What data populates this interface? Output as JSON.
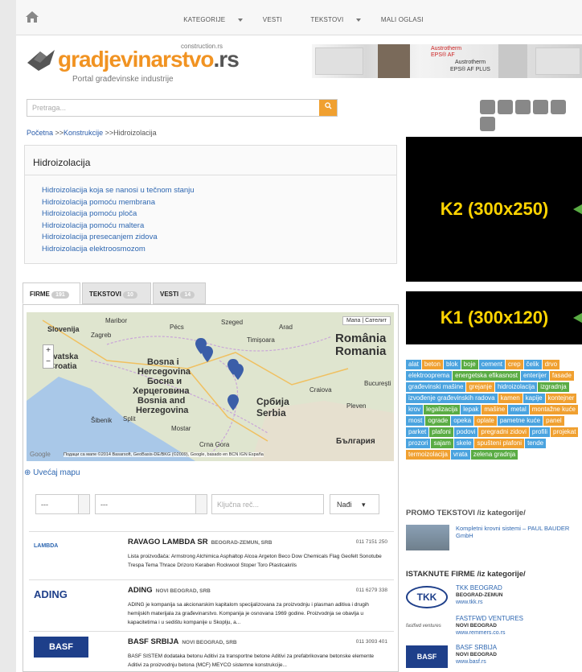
{
  "nav": {
    "items": [
      "KATEGORIJE",
      "VESTI",
      "TEKSTOVI",
      "MALI OGLASI"
    ]
  },
  "logo": {
    "small": "construction.rs",
    "name": "gradjevinarstvo",
    "tld": ".rs",
    "subtitle": "Portal građevinske industrije"
  },
  "top_banner": {
    "line1": "Austrotherm",
    "line2": "EPS® AF",
    "line3": "Austrotherm",
    "line4": "EPS® AF PLUS"
  },
  "search": {
    "placeholder": "Pretraga..."
  },
  "breadcrumb": {
    "home": "Početna",
    "sep1": " >>",
    "level1": "Konstrukcije",
    "sep2": " >>",
    "current": "Hidroizolacija"
  },
  "category": {
    "title": "Hidroizolacija",
    "items": [
      "Hidroizolacija koja se nanosi u tečnom stanju",
      "Hidroizolacija pomoću membrana",
      "Hidroizolacija pomoću ploča",
      "Hidroizolacija pomoću maltera",
      "Hidroizolacija presecanjem zidova",
      "Hidroizolacija elektroosmozom"
    ]
  },
  "tabs": [
    {
      "label": "FIRME",
      "count": "191"
    },
    {
      "label": "TEKSTOVI",
      "count": "10"
    },
    {
      "label": "VESTI",
      "count": "14"
    }
  ],
  "map": {
    "controls": "Мапа | Сателит",
    "labels": [
      "Slovenija",
      "Zagreb",
      "Hrvatska",
      "Croatia",
      "Bosna i",
      "Hercegovina",
      "Босна и",
      "Херцеговина",
      "Bosnia and",
      "Herzegovina",
      "Србија",
      "Serbia",
      "România",
      "Romania",
      "Crna Gora",
      "България",
      "Szeged",
      "Arad",
      "Timișoara",
      "Pécs",
      "Maribor",
      "Split",
      "Šibenik",
      "Mostar",
      "Craiova",
      "București",
      "Pleven"
    ],
    "attribution": "Подаци са мапе ©2014 Basarsoft, GeoBasis-DE/BKG (©2009), Google, basado en BCN IGN España",
    "google": "Google"
  },
  "zoom_map": "Uvećaj mapu",
  "filters": {
    "sel1": "---",
    "sel2": "---",
    "keyword_placeholder": "Ključna reč...",
    "button": "Nađi"
  },
  "firms": [
    {
      "logo": "LAMBDA",
      "name": "RAVAGO LAMBDA SR",
      "loc": "BEOGRAD-ZEMUN, SRB",
      "phone": "011 7151 250",
      "desc": "Lista proizvođača: Armstrong Alchimica Asphaltop Alcoa Argeton Beco Dow Chemicals Flag Geofelt Sonotube Trespa Tema Thrace Drizoro Keraben Rockwool Stoper Toro Plasticakrils"
    },
    {
      "logo": "ADING",
      "name": "ADING",
      "loc": "NOVI BEOGRAD, SRB",
      "phone": "011 6279 338",
      "desc": "ADING je kompanija sa akcionarskim kapitalom specijalizovana za proizvodnju i plasman aditiva i drugih hemijskih materijala za građevinarstvo. Kompanija je osnovana 1969 godine. Proizvodnja se obavlja u kapacitetima i u sedištu kompanije u Skoplju, a..."
    },
    {
      "logo": "BASF",
      "name": "BASF SRBIJA",
      "loc": "NOVI BEOGRAD, SRB",
      "phone": "011 3093 401",
      "desc": "BASF SISTEM dodataka betonu Aditivi za transportne betone Aditivi za prefabrikovane betonske elemente Aditivi za proizvodnju betona (MCF) MEYCO sistemne konstrukcije..."
    }
  ],
  "ads": {
    "k2": "K2 (300x250)",
    "k1": "K1 (300x120)"
  },
  "tags": [
    "alat",
    "beton",
    "blok",
    "boje",
    "cement",
    "crep",
    "čelik",
    "drvo",
    "elektrooprema",
    "energetska efikasnost",
    "enterijer",
    "fasade",
    "građevinski mašine",
    "grejanje",
    "hidroizolacija",
    "izgradnja",
    "izvođenje građevinskih radova",
    "kamen",
    "kapije",
    "kontejner",
    "krov",
    "legalizacija",
    "lepak",
    "mašine",
    "metal",
    "montažne kuće",
    "most",
    "ograde",
    "opeka",
    "oplate",
    "pametne kuće",
    "panel",
    "parket",
    "plafoni",
    "podovi",
    "pregradni zidovi",
    "profili",
    "projekat",
    "prozori",
    "sajam",
    "skele",
    "spušteni plafoni",
    "tende",
    "termoizolacija",
    "vrata",
    "zelena gradnja"
  ],
  "tag_colors": [
    "#4aa3df",
    "#f0a030",
    "#4aa3df",
    "#5aac44",
    "#4aa3df",
    "#f0a030"
  ],
  "promo": {
    "heading": "PROMO TEKSTOVI",
    "sub": "/iz kategorije/",
    "item": "Kompletni krovni sistemi – PAUL BAUDER GmbH"
  },
  "istaknute": {
    "heading": "ISTAKNUTE FIRME",
    "sub": "/iz kategorije/",
    "items": [
      {
        "logo": "TKK",
        "name": "TKK BEOGRAD",
        "city": "BEOGRAD-ZEMUN",
        "web": "www.tkk.rs"
      },
      {
        "logo": "fastfwd ventures",
        "name": "FASTFWD VENTURES",
        "city": "NOVI BEOGRAD",
        "web": "www.remmers.co.rs"
      },
      {
        "logo": "BASF",
        "name": "BASF SRBIJA",
        "city": "NOVI BEOGRAD",
        "web": "www.basf.rs"
      }
    ]
  }
}
